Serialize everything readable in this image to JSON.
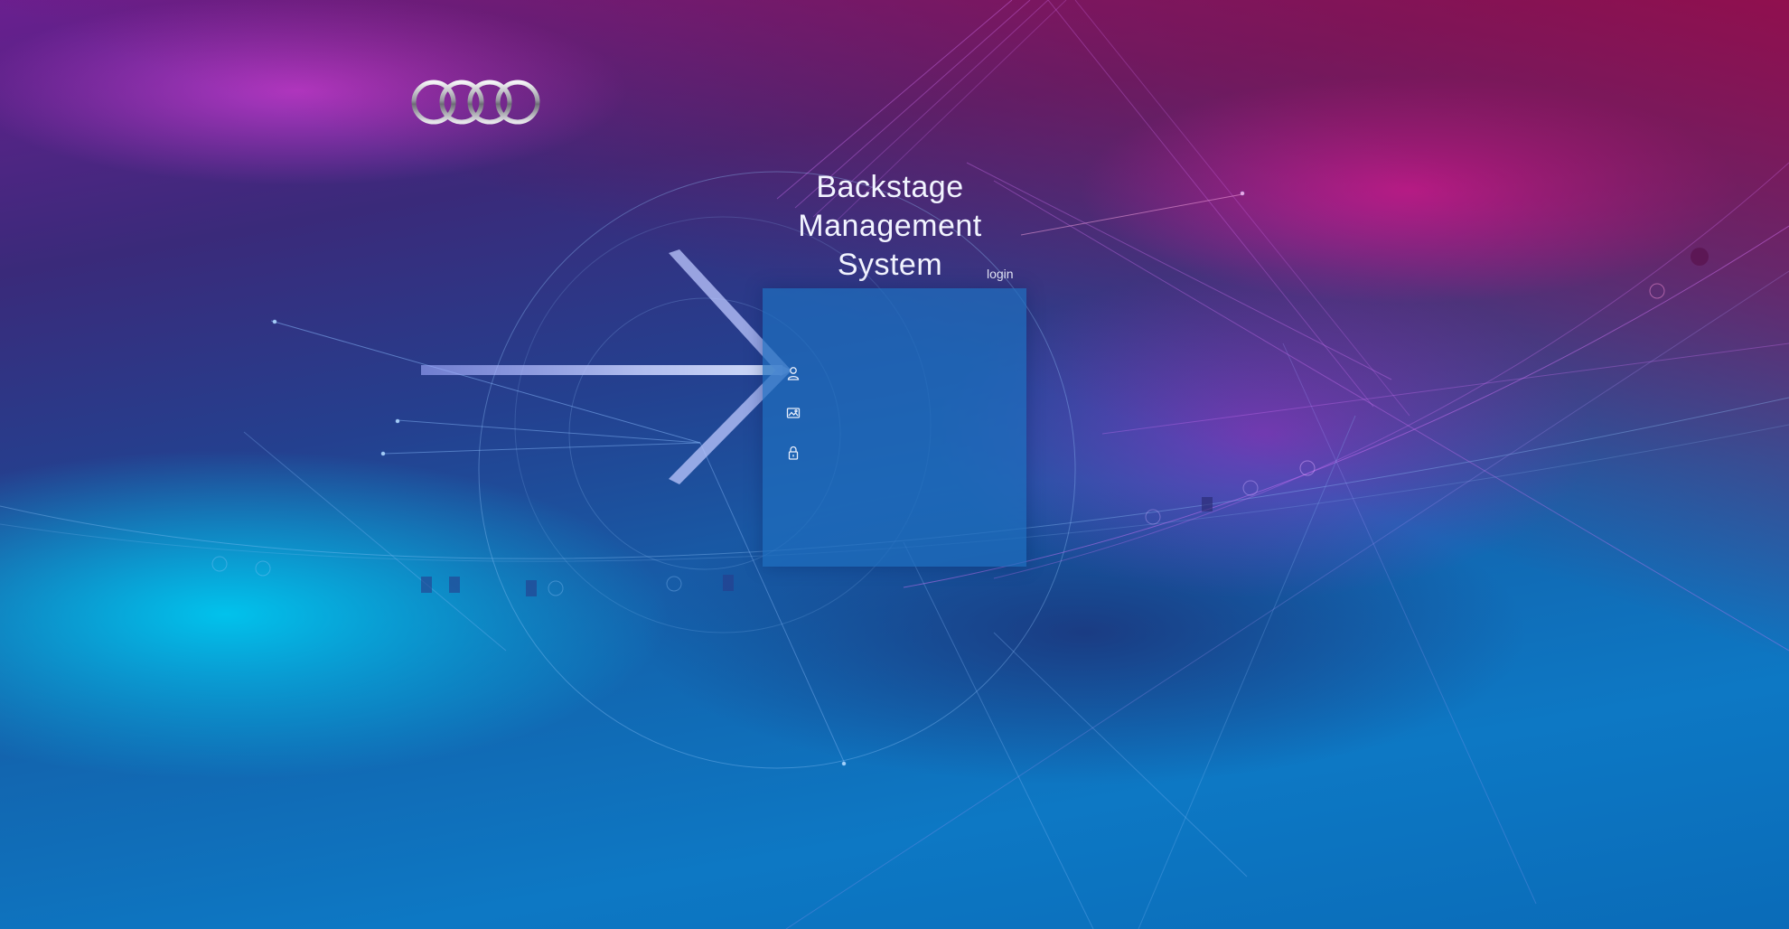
{
  "app": {
    "title": "Backstage\nManagement\nSystem",
    "login_label": "login"
  },
  "brand": {
    "logo_icon": "four-rings-logo"
  },
  "form": {
    "username": {
      "icon": "user-icon",
      "value": "",
      "placeholder": ""
    },
    "captcha": {
      "icon": "image-captcha-icon",
      "value": "",
      "placeholder": ""
    },
    "password": {
      "icon": "lock-icon",
      "value": "",
      "placeholder": ""
    }
  },
  "colors": {
    "panel": "#1e6ebe",
    "title_text": "#f2f4ff",
    "magenta_glow": "#e628c8",
    "cyan_glow": "#00c8f0",
    "crimson_top": "#a00a46"
  }
}
